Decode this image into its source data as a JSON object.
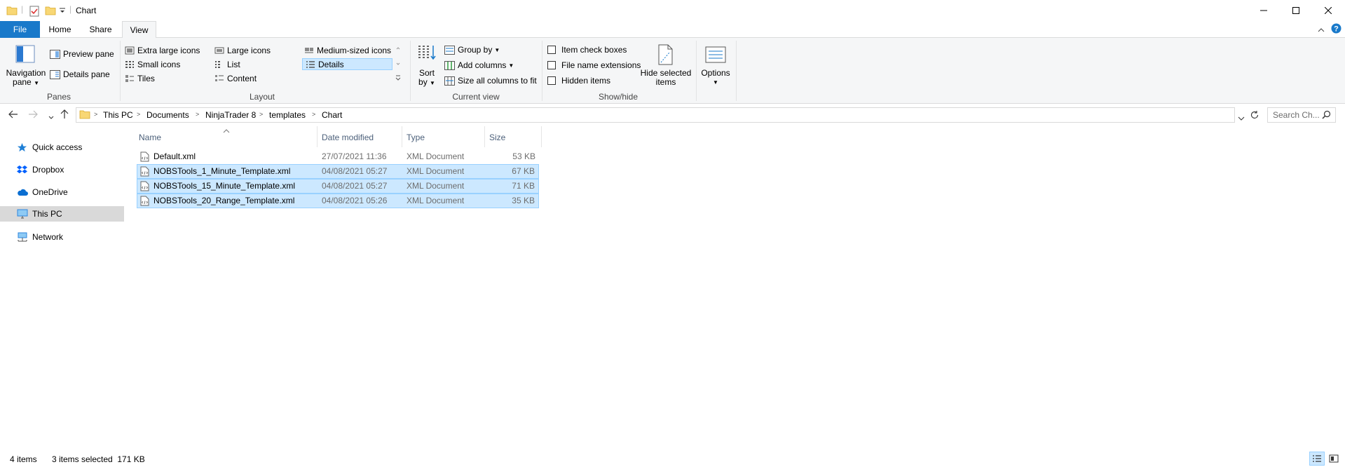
{
  "window": {
    "title": "Chart",
    "minimize_glyph": "—",
    "maximize_glyph": "☐",
    "close_glyph": "✕"
  },
  "ribbon_tabs": {
    "file": "File",
    "home": "Home",
    "share": "Share",
    "view": "View",
    "active": "View"
  },
  "ribbon": {
    "panes": {
      "group_label": "Panes",
      "navigation_pane_line1": "Navigation",
      "navigation_pane_line2": "pane",
      "preview_pane": "Preview pane",
      "details_pane": "Details pane"
    },
    "layout": {
      "group_label": "Layout",
      "extra_large_icons": "Extra large icons",
      "large_icons": "Large icons",
      "medium_icons": "Medium-sized icons",
      "small_icons": "Small icons",
      "list": "List",
      "details": "Details",
      "tiles": "Tiles",
      "content": "Content",
      "selected": "Details"
    },
    "current_view": {
      "group_label": "Current view",
      "sort_by_line1": "Sort",
      "sort_by_line2": "by",
      "group_by": "Group by",
      "add_columns": "Add columns",
      "size_all_columns": "Size all columns to fit"
    },
    "show_hide": {
      "group_label": "Show/hide",
      "item_check_boxes": "Item check boxes",
      "file_name_extensions": "File name extensions",
      "hidden_items": "Hidden items",
      "hide_selected_line1": "Hide selected",
      "hide_selected_line2": "items"
    },
    "options": {
      "label": "Options"
    }
  },
  "address": {
    "breadcrumbs": [
      "This PC",
      "Documents",
      "NinjaTrader 8",
      "templates",
      "Chart"
    ],
    "search_placeholder": "Search Ch..."
  },
  "nav_pane": {
    "items": [
      {
        "label": "Quick access",
        "icon": "star-icon",
        "color": "#1e7fd6"
      },
      {
        "label": "Dropbox",
        "icon": "dropbox-icon",
        "color": "#0061fe"
      },
      {
        "label": "OneDrive",
        "icon": "cloud-icon",
        "color": "#0a6ed1"
      },
      {
        "label": "This PC",
        "icon": "computer-icon",
        "color": "#2e86de",
        "selected": true
      },
      {
        "label": "Network",
        "icon": "network-icon",
        "color": "#2e86de"
      }
    ]
  },
  "file_list": {
    "columns": [
      "Name",
      "Date modified",
      "Type",
      "Size"
    ],
    "rows": [
      {
        "name": "Default.xml",
        "date": "27/07/2021 11:36",
        "type": "XML Document",
        "size": "53 KB",
        "selected": false
      },
      {
        "name": "NOBSTools_1_Minute_Template.xml",
        "date": "04/08/2021 05:27",
        "type": "XML Document",
        "size": "67 KB",
        "selected": true
      },
      {
        "name": "NOBSTools_15_Minute_Template.xml",
        "date": "04/08/2021 05:27",
        "type": "XML Document",
        "size": "71 KB",
        "selected": true
      },
      {
        "name": "NOBSTools_20_Range_Template.xml",
        "date": "04/08/2021 05:26",
        "type": "XML Document",
        "size": "35 KB",
        "selected": true
      }
    ]
  },
  "status": {
    "item_count": "4 items",
    "selection": "3 items selected  171 KB"
  },
  "colors": {
    "accent": "#1979ca",
    "selection_bg": "#cce8ff",
    "selection_border": "#99d1ff",
    "folder": "#f8d775"
  }
}
